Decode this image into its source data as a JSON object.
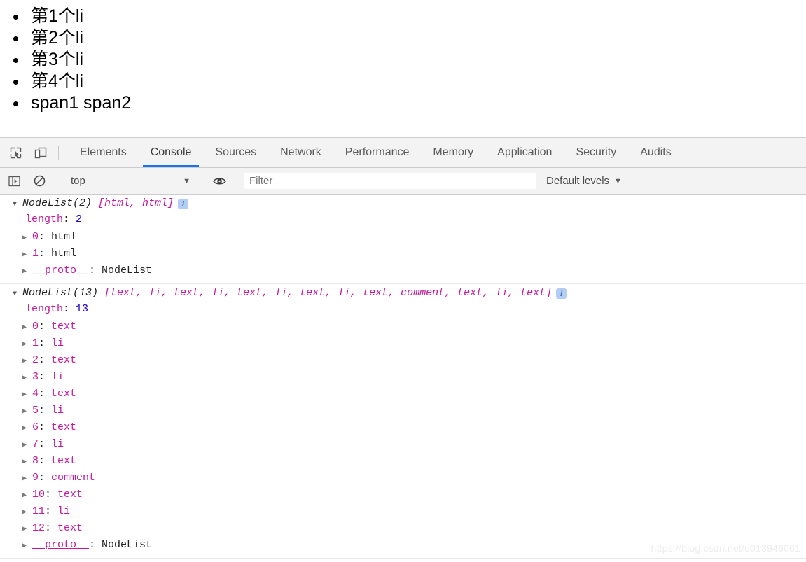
{
  "page": {
    "list_items": [
      "第1个li",
      "第2个li",
      "第3个li",
      "第4个li",
      "span1 span2"
    ]
  },
  "devtools": {
    "tabs": [
      {
        "label": "Elements",
        "active": false
      },
      {
        "label": "Console",
        "active": true
      },
      {
        "label": "Sources",
        "active": false
      },
      {
        "label": "Network",
        "active": false
      },
      {
        "label": "Performance",
        "active": false
      },
      {
        "label": "Memory",
        "active": false
      },
      {
        "label": "Application",
        "active": false
      },
      {
        "label": "Security",
        "active": false
      },
      {
        "label": "Audits",
        "active": false
      }
    ],
    "icons": {
      "inspect": "inspect-element-icon",
      "device": "device-toolbar-icon",
      "sidebar": "console-sidebar-icon",
      "clear": "clear-console-icon",
      "eye": "live-expression-eye-icon"
    },
    "console_toolbar": {
      "context": "top",
      "context_caret": "▼",
      "filter_placeholder": "Filter",
      "filter_value": "",
      "levels_label": "Default levels",
      "levels_caret": "▼"
    },
    "accent_color": "#1a73e8",
    "property_color": "#c41a9b",
    "number_color": "#1c00cf",
    "toolbar_bg": "#f3f3f3"
  },
  "console": {
    "entries": [
      {
        "triangle": "▼",
        "type_name": "NodeList(2)",
        "preview": " [html, html]",
        "badge": "i",
        "rows": [
          {
            "expandable": false,
            "key": "length",
            "sep": ": ",
            "value": "2",
            "value_kind": "num"
          },
          {
            "expandable": true,
            "key": "0",
            "sep": ": ",
            "value": "html",
            "value_kind": "plain"
          },
          {
            "expandable": true,
            "key": "1",
            "sep": ": ",
            "value": "html",
            "value_kind": "plain"
          },
          {
            "expandable": true,
            "key": "__proto__",
            "sep": ": ",
            "value": "NodeList",
            "value_kind": "plain"
          }
        ]
      },
      {
        "triangle": "▼",
        "type_name": "NodeList(13)",
        "preview": " [text, li, text, li, text, li, text, li, text, comment, text, li, text]",
        "badge": "i",
        "rows": [
          {
            "expandable": false,
            "key": "length",
            "sep": ": ",
            "value": "13",
            "value_kind": "num"
          },
          {
            "expandable": true,
            "key": "0",
            "sep": ": ",
            "value": "text",
            "value_kind": "val"
          },
          {
            "expandable": true,
            "key": "1",
            "sep": ": ",
            "value": "li",
            "value_kind": "val"
          },
          {
            "expandable": true,
            "key": "2",
            "sep": ": ",
            "value": "text",
            "value_kind": "val"
          },
          {
            "expandable": true,
            "key": "3",
            "sep": ": ",
            "value": "li",
            "value_kind": "val"
          },
          {
            "expandable": true,
            "key": "4",
            "sep": ": ",
            "value": "text",
            "value_kind": "val"
          },
          {
            "expandable": true,
            "key": "5",
            "sep": ": ",
            "value": "li",
            "value_kind": "val"
          },
          {
            "expandable": true,
            "key": "6",
            "sep": ": ",
            "value": "text",
            "value_kind": "val"
          },
          {
            "expandable": true,
            "key": "7",
            "sep": ": ",
            "value": "li",
            "value_kind": "val"
          },
          {
            "expandable": true,
            "key": "8",
            "sep": ": ",
            "value": "text",
            "value_kind": "val"
          },
          {
            "expandable": true,
            "key": "9",
            "sep": ": ",
            "value": "comment",
            "value_kind": "val"
          },
          {
            "expandable": true,
            "key": "10",
            "sep": ": ",
            "value": "text",
            "value_kind": "val"
          },
          {
            "expandable": true,
            "key": "11",
            "sep": ": ",
            "value": "li",
            "value_kind": "val"
          },
          {
            "expandable": true,
            "key": "12",
            "sep": ": ",
            "value": "text",
            "value_kind": "val"
          },
          {
            "expandable": true,
            "key": "__proto__",
            "sep": ": ",
            "value": "NodeList",
            "value_kind": "plain"
          }
        ]
      }
    ]
  },
  "watermark": {
    "text": "https://blog.csdn.net/u013946061"
  }
}
